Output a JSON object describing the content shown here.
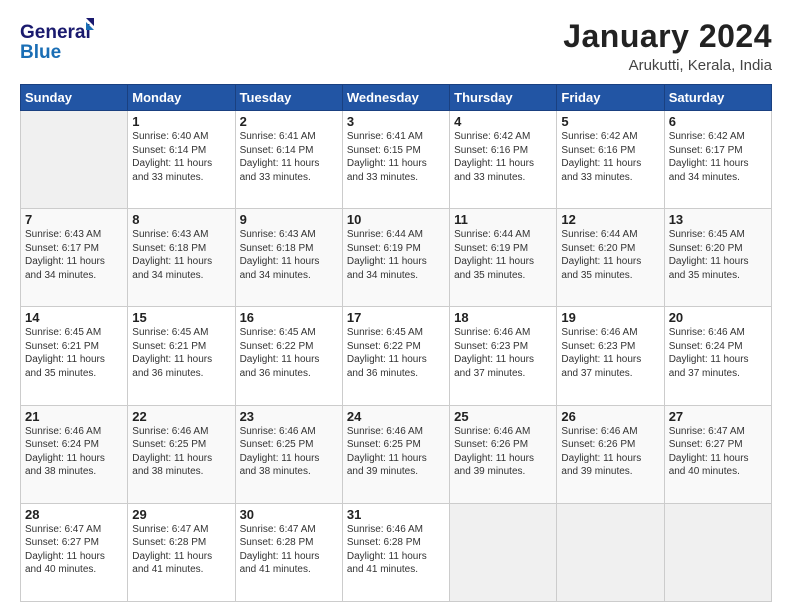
{
  "logo": {
    "line1": "General",
    "line2": "Blue"
  },
  "title": "January 2024",
  "subtitle": "Arukutti, Kerala, India",
  "weekdays": [
    "Sunday",
    "Monday",
    "Tuesday",
    "Wednesday",
    "Thursday",
    "Friday",
    "Saturday"
  ],
  "weeks": [
    [
      {
        "num": "",
        "info": ""
      },
      {
        "num": "1",
        "info": "Sunrise: 6:40 AM\nSunset: 6:14 PM\nDaylight: 11 hours\nand 33 minutes."
      },
      {
        "num": "2",
        "info": "Sunrise: 6:41 AM\nSunset: 6:14 PM\nDaylight: 11 hours\nand 33 minutes."
      },
      {
        "num": "3",
        "info": "Sunrise: 6:41 AM\nSunset: 6:15 PM\nDaylight: 11 hours\nand 33 minutes."
      },
      {
        "num": "4",
        "info": "Sunrise: 6:42 AM\nSunset: 6:16 PM\nDaylight: 11 hours\nand 33 minutes."
      },
      {
        "num": "5",
        "info": "Sunrise: 6:42 AM\nSunset: 6:16 PM\nDaylight: 11 hours\nand 33 minutes."
      },
      {
        "num": "6",
        "info": "Sunrise: 6:42 AM\nSunset: 6:17 PM\nDaylight: 11 hours\nand 34 minutes."
      }
    ],
    [
      {
        "num": "7",
        "info": "Sunrise: 6:43 AM\nSunset: 6:17 PM\nDaylight: 11 hours\nand 34 minutes."
      },
      {
        "num": "8",
        "info": "Sunrise: 6:43 AM\nSunset: 6:18 PM\nDaylight: 11 hours\nand 34 minutes."
      },
      {
        "num": "9",
        "info": "Sunrise: 6:43 AM\nSunset: 6:18 PM\nDaylight: 11 hours\nand 34 minutes."
      },
      {
        "num": "10",
        "info": "Sunrise: 6:44 AM\nSunset: 6:19 PM\nDaylight: 11 hours\nand 34 minutes."
      },
      {
        "num": "11",
        "info": "Sunrise: 6:44 AM\nSunset: 6:19 PM\nDaylight: 11 hours\nand 35 minutes."
      },
      {
        "num": "12",
        "info": "Sunrise: 6:44 AM\nSunset: 6:20 PM\nDaylight: 11 hours\nand 35 minutes."
      },
      {
        "num": "13",
        "info": "Sunrise: 6:45 AM\nSunset: 6:20 PM\nDaylight: 11 hours\nand 35 minutes."
      }
    ],
    [
      {
        "num": "14",
        "info": "Sunrise: 6:45 AM\nSunset: 6:21 PM\nDaylight: 11 hours\nand 35 minutes."
      },
      {
        "num": "15",
        "info": "Sunrise: 6:45 AM\nSunset: 6:21 PM\nDaylight: 11 hours\nand 36 minutes."
      },
      {
        "num": "16",
        "info": "Sunrise: 6:45 AM\nSunset: 6:22 PM\nDaylight: 11 hours\nand 36 minutes."
      },
      {
        "num": "17",
        "info": "Sunrise: 6:45 AM\nSunset: 6:22 PM\nDaylight: 11 hours\nand 36 minutes."
      },
      {
        "num": "18",
        "info": "Sunrise: 6:46 AM\nSunset: 6:23 PM\nDaylight: 11 hours\nand 37 minutes."
      },
      {
        "num": "19",
        "info": "Sunrise: 6:46 AM\nSunset: 6:23 PM\nDaylight: 11 hours\nand 37 minutes."
      },
      {
        "num": "20",
        "info": "Sunrise: 6:46 AM\nSunset: 6:24 PM\nDaylight: 11 hours\nand 37 minutes."
      }
    ],
    [
      {
        "num": "21",
        "info": "Sunrise: 6:46 AM\nSunset: 6:24 PM\nDaylight: 11 hours\nand 38 minutes."
      },
      {
        "num": "22",
        "info": "Sunrise: 6:46 AM\nSunset: 6:25 PM\nDaylight: 11 hours\nand 38 minutes."
      },
      {
        "num": "23",
        "info": "Sunrise: 6:46 AM\nSunset: 6:25 PM\nDaylight: 11 hours\nand 38 minutes."
      },
      {
        "num": "24",
        "info": "Sunrise: 6:46 AM\nSunset: 6:25 PM\nDaylight: 11 hours\nand 39 minutes."
      },
      {
        "num": "25",
        "info": "Sunrise: 6:46 AM\nSunset: 6:26 PM\nDaylight: 11 hours\nand 39 minutes."
      },
      {
        "num": "26",
        "info": "Sunrise: 6:46 AM\nSunset: 6:26 PM\nDaylight: 11 hours\nand 39 minutes."
      },
      {
        "num": "27",
        "info": "Sunrise: 6:47 AM\nSunset: 6:27 PM\nDaylight: 11 hours\nand 40 minutes."
      }
    ],
    [
      {
        "num": "28",
        "info": "Sunrise: 6:47 AM\nSunset: 6:27 PM\nDaylight: 11 hours\nand 40 minutes."
      },
      {
        "num": "29",
        "info": "Sunrise: 6:47 AM\nSunset: 6:28 PM\nDaylight: 11 hours\nand 41 minutes."
      },
      {
        "num": "30",
        "info": "Sunrise: 6:47 AM\nSunset: 6:28 PM\nDaylight: 11 hours\nand 41 minutes."
      },
      {
        "num": "31",
        "info": "Sunrise: 6:46 AM\nSunset: 6:28 PM\nDaylight: 11 hours\nand 41 minutes."
      },
      {
        "num": "",
        "info": ""
      },
      {
        "num": "",
        "info": ""
      },
      {
        "num": "",
        "info": ""
      }
    ]
  ]
}
